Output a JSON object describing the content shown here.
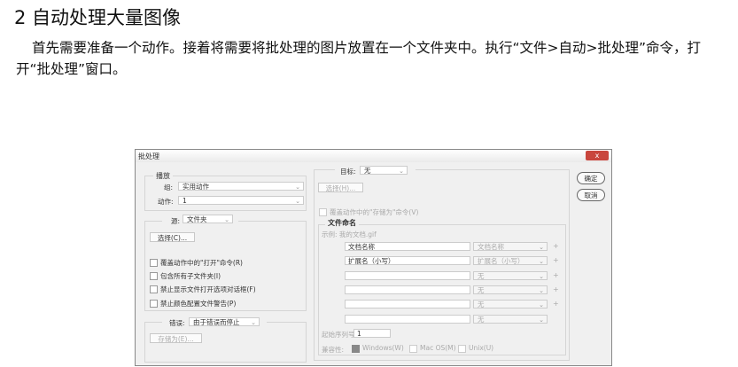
{
  "heading": "2 自动处理大量图像",
  "paragraph": "首先需要准备一个动作。接着将需要将批处理的图片放置在一个文件夹中。执行“文件>自动>批处理”命令，打开“批处理”窗口。",
  "dialog": {
    "title": "批处理",
    "close": "x",
    "play": {
      "legend": "播放",
      "group_label": "组:",
      "group_value": "实用动作",
      "action_label": "动作:",
      "action_value": "1"
    },
    "source": {
      "label": "源:",
      "value": "文件夹",
      "choose": "选择(C)...",
      "checkboxes": [
        "覆盖动作中的\"打开\"命令(R)",
        "包含所有子文件夹(I)",
        "禁止显示文件打开选项对话框(F)",
        "禁止颜色配置文件警告(P)"
      ]
    },
    "error": {
      "label": "错误:",
      "value": "由于错误而停止",
      "save_as": "存储为(E)..."
    },
    "target": {
      "label": "目标:",
      "value": "无",
      "choose": "选择(H)...",
      "override": "覆盖动作中的\"存储为\"命令(V)"
    },
    "naming": {
      "legend": "文件命名",
      "example": "示例: 我的文档.gif",
      "rows": [
        {
          "input": "文档名称",
          "select": "文档名称"
        },
        {
          "input": "扩展名（小写）",
          "select": "扩展名（小写）"
        },
        {
          "input": "",
          "select": "无"
        },
        {
          "input": "",
          "select": "无"
        },
        {
          "input": "",
          "select": "无"
        },
        {
          "input": "",
          "select": "无"
        }
      ],
      "plus": "+",
      "serial_label": "起始序列号:",
      "serial_value": "1",
      "compat_label": "兼容性:",
      "compat": [
        "Windows(W)",
        "Mac OS(M)",
        "Unix(U)"
      ]
    },
    "ok": "确定",
    "cancel": "取消"
  }
}
